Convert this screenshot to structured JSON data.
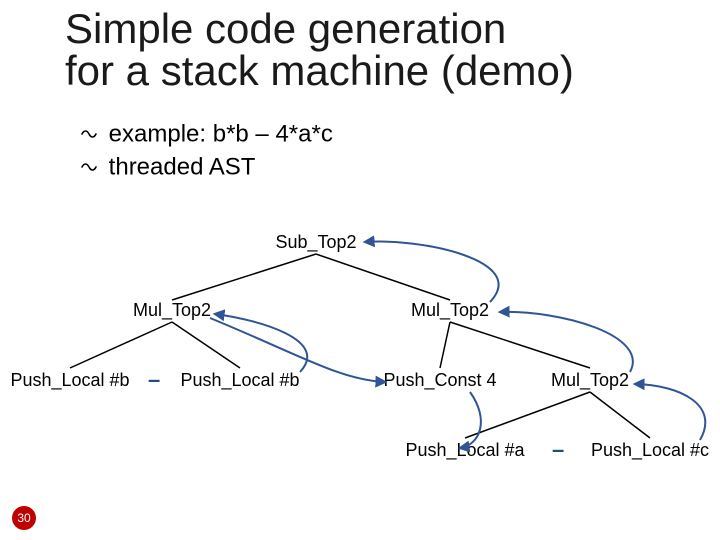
{
  "title_line1": "Simple code generation",
  "title_line2": "for a stack machine (demo)",
  "bullets": [
    "example: b*b – 4*a*c",
    "threaded AST"
  ],
  "nodes": {
    "root": "Sub_Top2",
    "l": "Mul_Top2",
    "r": "Mul_Top2",
    "ll": "Push_Local #b",
    "lr": "Push_Local #b",
    "rl": "Push_Const 4",
    "rr": "Mul_Top2",
    "rrl": "Push_Local #a",
    "rrr": "Push_Local #c"
  },
  "dashes": {
    "l_children": "–",
    "rr_children": "–"
  },
  "page_number": "30",
  "colors": {
    "thread_arrow": "#2f5597",
    "tree_edge": "#000000",
    "dash": "#1e4e79",
    "page_bg": "#c00000"
  },
  "chart_data": {
    "type": "tree",
    "expression": "b*b - 4*a*c",
    "root": {
      "label": "Sub_Top2",
      "children": [
        {
          "label": "Mul_Top2",
          "children": [
            {
              "label": "Push_Local #b"
            },
            {
              "label": "Push_Local #b"
            }
          ]
        },
        {
          "label": "Mul_Top2",
          "children": [
            {
              "label": "Push_Const 4"
            },
            {
              "label": "Mul_Top2",
              "children": [
                {
                  "label": "Push_Local #a"
                },
                {
                  "label": "Push_Local #c"
                }
              ]
            }
          ]
        }
      ]
    },
    "threading_order": [
      "Push_Local #b",
      "Push_Local #b",
      "Mul_Top2",
      "Push_Const 4",
      "Push_Local #a",
      "Push_Local #c",
      "Mul_Top2",
      "Mul_Top2",
      "Sub_Top2"
    ]
  }
}
